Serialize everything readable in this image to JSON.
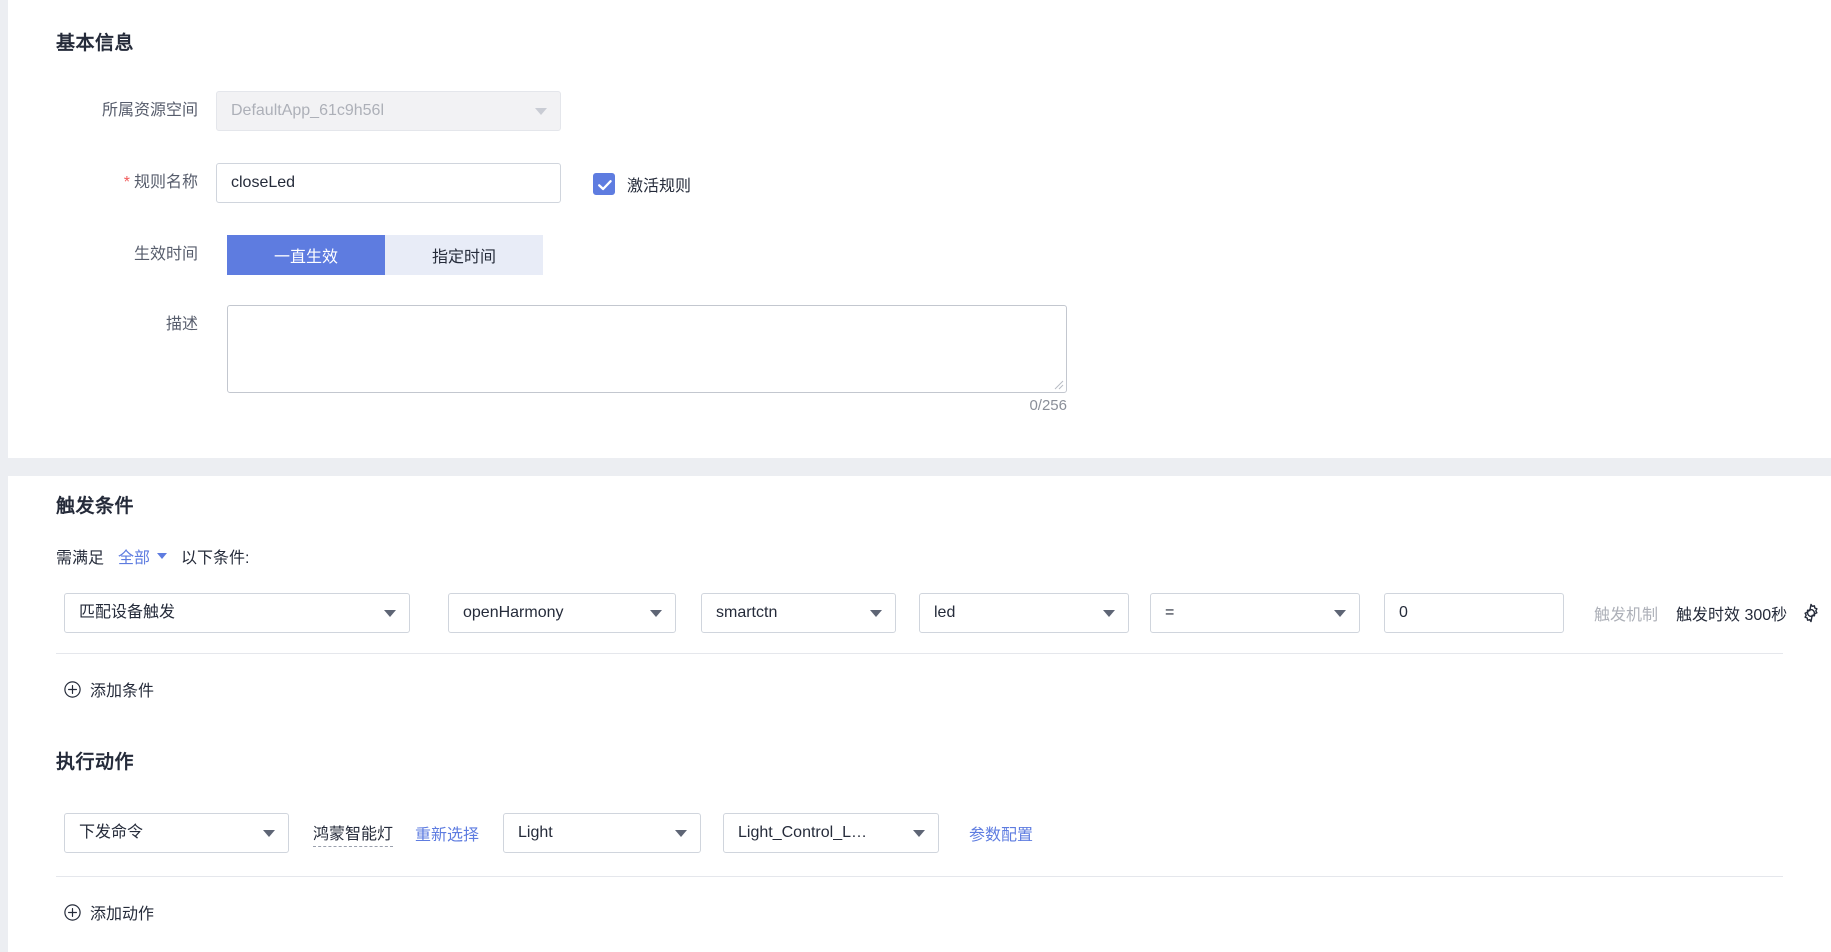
{
  "basic": {
    "title": "基本信息",
    "resource_space": {
      "label": "所属资源空间",
      "value": "DefaultApp_61c9h56l",
      "disabled": true
    },
    "rule_name": {
      "label": "规则名称",
      "required_mark": "*",
      "value": "closeLed",
      "placeholder": ""
    },
    "activate": {
      "label": "激活规则",
      "checked": true
    },
    "effective_time": {
      "label": "生效时间",
      "options": [
        "一直生效",
        "指定时间"
      ],
      "selected_index": 0
    },
    "description": {
      "label": "描述",
      "value": "",
      "placeholder": "",
      "counter": "0/256"
    }
  },
  "trigger": {
    "title": "触发条件",
    "prefix": "需满足",
    "match_mode": "全部",
    "suffix": "以下条件:",
    "condition": {
      "type": "匹配设备触发",
      "product": "openHarmony",
      "device": "smartctn",
      "property": "led",
      "operator": "=",
      "value": "0",
      "mechanism_label": "触发机制",
      "validity_label": "触发时效 300秒",
      "settings_icon": "gear-icon"
    },
    "add_condition": "添加条件"
  },
  "action": {
    "title": "执行动作",
    "row": {
      "type": "下发命令",
      "device_name": "鸿蒙智能灯",
      "reselect_link": "重新选择",
      "service": "Light",
      "command": "Light_Control_L…",
      "param_config_link": "参数配置"
    },
    "add_action": "添加动作"
  },
  "colors": {
    "accent": "#5e7ce0",
    "accent_soft": "#e8ecf7",
    "required": "#f15b5b",
    "text": "#252b3a",
    "muted": "#adb0b8",
    "page_bg": "#eceef2",
    "border": "#d0d5dd"
  }
}
